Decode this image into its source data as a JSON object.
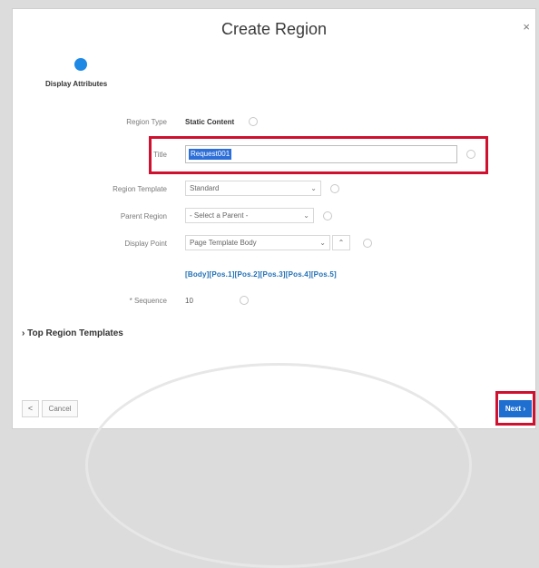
{
  "dialog": {
    "title": "Create Region",
    "close_icon": "×"
  },
  "wizard": {
    "step_label": "Display Attributes"
  },
  "form": {
    "region_type": {
      "label": "Region Type",
      "value": "Static Content"
    },
    "title": {
      "label": "Title",
      "value": "Request001"
    },
    "region_template": {
      "label": "Region Template",
      "value": "Standard"
    },
    "parent_region": {
      "label": "Parent Region",
      "value": "- Select a Parent -"
    },
    "display_point": {
      "label": "Display Point",
      "value": "Page Template Body"
    },
    "position_tokens": "[Body][Pos.1][Pos.2][Pos.3][Pos.4][Pos.5]",
    "sequence": {
      "label": "Sequence",
      "value": "10"
    }
  },
  "sections": {
    "top_region_templates": "Top Region Templates"
  },
  "footer": {
    "back_icon": "<",
    "cancel_label": "Cancel",
    "next_label": "Next"
  },
  "colors": {
    "accent": "#1f6fd1",
    "highlight": "#d0102f"
  }
}
